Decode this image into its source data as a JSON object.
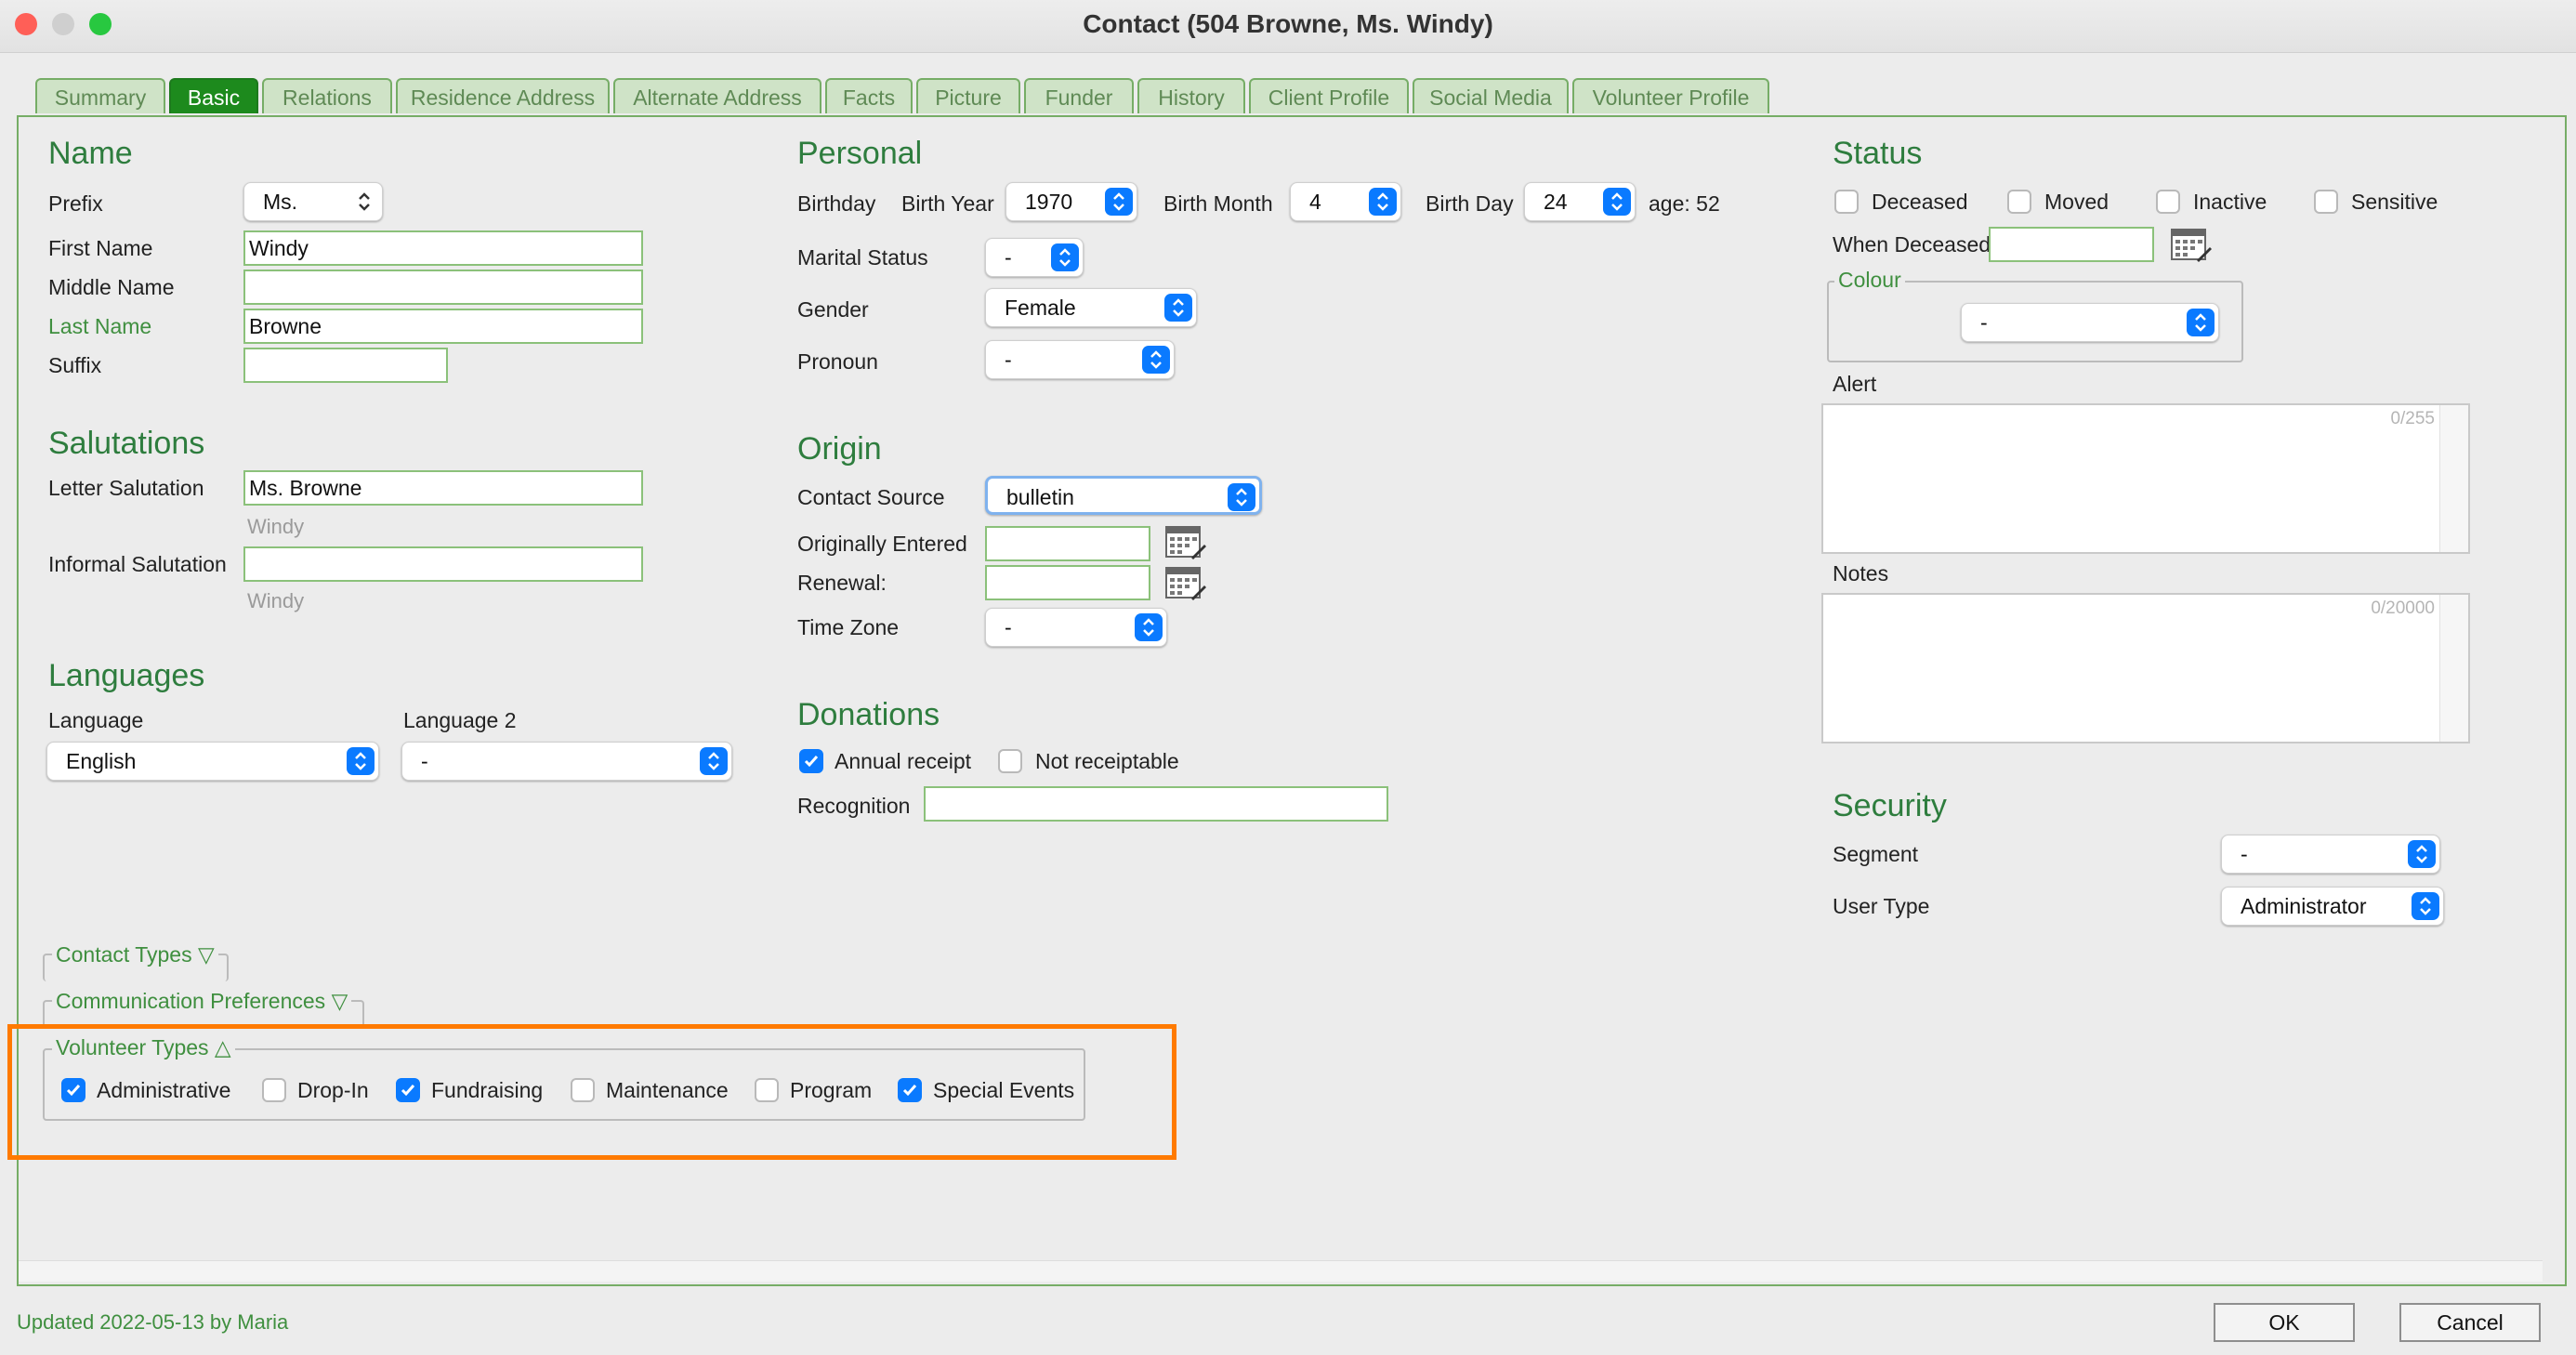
{
  "window": {
    "title": "Contact (504  Browne, Ms. Windy)"
  },
  "tabs": [
    "Summary",
    "Basic",
    "Relations",
    "Residence Address",
    "Alternate Address",
    "Facts",
    "Picture",
    "Funder",
    "History",
    "Client Profile",
    "Social Media",
    "Volunteer Profile"
  ],
  "active_tab": "Basic",
  "name": {
    "heading": "Name",
    "prefix_label": "Prefix",
    "prefix_value": "Ms.",
    "first_label": "First Name",
    "first_value": "Windy",
    "middle_label": "Middle Name",
    "middle_value": "",
    "last_label": "Last Name",
    "last_value": "Browne",
    "suffix_label": "Suffix",
    "suffix_value": ""
  },
  "salutations": {
    "heading": "Salutations",
    "letter_label": "Letter Salutation",
    "letter_value": "Ms. Browne",
    "letter_hint": "Windy",
    "informal_label": "Informal Salutation",
    "informal_value": "",
    "informal_hint": "Windy"
  },
  "languages": {
    "heading": "Languages",
    "language_label": "Language",
    "language_value": "English",
    "language2_label": "Language 2",
    "language2_value": "-"
  },
  "personal": {
    "heading": "Personal",
    "birthday_label": "Birthday",
    "birth_year_label": "Birth Year",
    "birth_year": "1970",
    "birth_month_label": "Birth Month",
    "birth_month": "4",
    "birth_day_label": "Birth Day",
    "birth_day": "24",
    "age_text": "age: 52",
    "marital_label": "Marital Status",
    "marital_value": "-",
    "gender_label": "Gender",
    "gender_value": "Female",
    "pronoun_label": "Pronoun",
    "pronoun_value": "-"
  },
  "origin": {
    "heading": "Origin",
    "source_label": "Contact Source",
    "source_value": "bulletin",
    "entered_label": "Originally Entered",
    "entered_value": "",
    "renewal_label": "Renewal:",
    "renewal_value": "",
    "timezone_label": "Time Zone",
    "timezone_value": "-"
  },
  "donations": {
    "heading": "Donations",
    "annual_label": "Annual receipt",
    "annual_checked": true,
    "notreceipt_label": "Not receiptable",
    "notreceipt_checked": false,
    "recognition_label": "Recognition",
    "recognition_value": ""
  },
  "status": {
    "heading": "Status",
    "deceased_label": "Deceased",
    "moved_label": "Moved",
    "inactive_label": "Inactive",
    "sensitive_label": "Sensitive",
    "when_deceased_label": "When Deceased",
    "when_deceased_value": "",
    "colour_label": "Colour",
    "colour_value": "-",
    "alert_label": "Alert",
    "alert_count": "0/255",
    "notes_label": "Notes",
    "notes_count": "0/20000"
  },
  "security": {
    "heading": "Security",
    "segment_label": "Segment",
    "segment_value": "-",
    "usertype_label": "User Type",
    "usertype_value": "Administrator"
  },
  "collapsibles": {
    "contact_types": "Contact Types ▽",
    "communication": "Communication Preferences ▽",
    "volunteer_types": "Volunteer Types △"
  },
  "volunteer_types": [
    {
      "label": "Administrative",
      "checked": true
    },
    {
      "label": "Drop-In",
      "checked": false
    },
    {
      "label": "Fundraising",
      "checked": true
    },
    {
      "label": "Maintenance",
      "checked": false
    },
    {
      "label": "Program",
      "checked": false
    },
    {
      "label": "Special Events",
      "checked": true
    }
  ],
  "footer": {
    "updated": "Updated 2022-05-13 by Maria",
    "ok": "OK",
    "cancel": "Cancel"
  },
  "colors": {
    "accent_green": "#2e7d3e",
    "tab_active": "#1d8a1d",
    "highlight": "#ff7a00",
    "checkbox_blue": "#0a7aff"
  }
}
